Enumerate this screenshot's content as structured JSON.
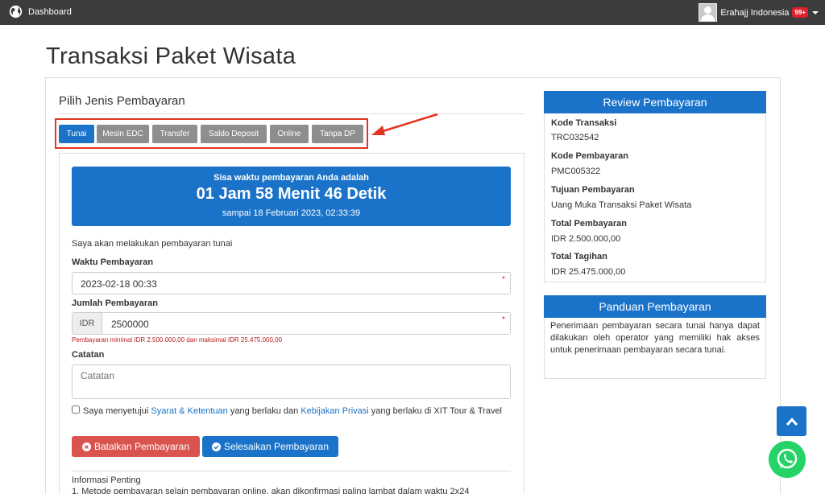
{
  "nav": {
    "brand": "Dashboard",
    "brand_icon": "globe-icon",
    "user_name": "Erahajj Indonesia",
    "notification_count": "99+"
  },
  "page": {
    "title": "Transaksi Paket Wisata"
  },
  "payment": {
    "section_title": "Pilih Jenis Pembayaran",
    "methods": [
      "Tunai",
      "Mesin EDC",
      "Transfer",
      "Saldo Deposit",
      "Online",
      "Tanpa DP"
    ],
    "active_method": "Tunai",
    "highlight_color": "#e53322"
  },
  "timer": {
    "heading": "Sisa waktu pembayaran Anda adalah",
    "countdown": "01 Jam 58 Menit 46 Detik",
    "deadline": "sampai 18 Februari 2023, 02:33:39"
  },
  "form": {
    "intro": "Saya akan melakukan pembayaran tunai",
    "time_label": "Waktu Pembayaran",
    "time_value": "2023-02-18 00:33",
    "amount_label": "Jumlah Pembayaran",
    "currency": "IDR",
    "amount_value": "2500000",
    "amount_hint": "Pembayaran minimal IDR 2.500.000,00 dan maksimal IDR 25.475.000,00",
    "note_label": "Catatan",
    "note_placeholder": "Catatan",
    "required_mark": "*",
    "agree_prefix": "Saya menyetujui",
    "agree_terms": "Syarat & Ketentuan",
    "agree_mid": "yang berlaku dan",
    "agree_privacy": "Kebijakan Privasi",
    "agree_suffix": "yang berlaku di XIT Tour & Travel",
    "cancel_label": "Batalkan Pembayaran",
    "submit_label": "Selesaikan Pembayaran",
    "info_title": "Informasi Penting",
    "info_line1": "1. Metode pembayaran selain pembayaran online, akan dikonfirmasi paling lambat dalam waktu 2x24"
  },
  "review": {
    "title": "Review Pembayaran",
    "rows": [
      {
        "key": "Kode Transaksi",
        "value": "TRC032542",
        "link": true
      },
      {
        "key": "Kode Pembayaran",
        "value": "PMC005322",
        "link": false
      },
      {
        "key": "Tujuan Pembayaran",
        "value": "Uang Muka Transaksi Paket Wisata",
        "link": false
      },
      {
        "key": "Total Pembayaran",
        "value": "IDR 2.500.000,00",
        "link": false
      },
      {
        "key": "Total Tagihan",
        "value": "IDR 25.475.000,00",
        "link": false
      }
    ]
  },
  "guide": {
    "title": "Panduan Pembayaran",
    "text": "Penerimaan pembayaran secara tunai hanya dapat dilakukan oleh operator yang memiliki hak akses untuk penerimaan pembayaran secara tunai."
  },
  "colors": {
    "primary": "#1a73c9",
    "danger": "#d9534f",
    "navbar": "#3c3c3c"
  }
}
